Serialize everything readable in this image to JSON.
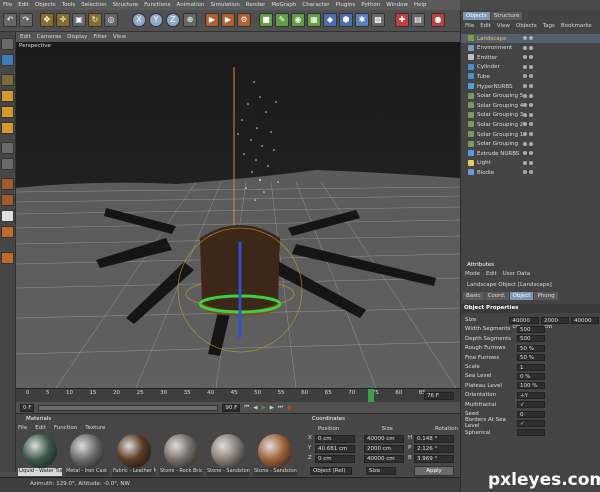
{
  "menu": [
    "File",
    "Edit",
    "Objects",
    "Tools",
    "Selection",
    "Structure",
    "Functions",
    "Animation",
    "Simulation",
    "Render",
    "MoGraph",
    "Character",
    "Plugins",
    "Python",
    "Window",
    "Help"
  ],
  "toolbar": {
    "axis_x": "X",
    "axis_y": "Y",
    "axis_z": "Z"
  },
  "viewport": {
    "menu": [
      "Edit",
      "Cameras",
      "Display",
      "Filter",
      "View"
    ],
    "label": "Perspective"
  },
  "timeline": {
    "ticks": [
      "0",
      "5",
      "10",
      "15",
      "20",
      "25",
      "30",
      "35",
      "40",
      "45",
      "50",
      "55",
      "60",
      "65",
      "70",
      "75",
      "80",
      "85"
    ],
    "end_frame": "76 F"
  },
  "transport": {
    "start": "0 F",
    "end": "90 F"
  },
  "materials": {
    "title": "Materials",
    "menu": [
      "File",
      "Edit",
      "Function",
      "Texture"
    ],
    "items": [
      {
        "label": "Liquid - Water Tur",
        "color": "#3d5a4c"
      },
      {
        "label": "Metal - Iron Cast",
        "color": "#6c6c6c"
      },
      {
        "label": "Fabric - Leather N",
        "color": "#5a3a24"
      },
      {
        "label": "Stone - Rock Bric",
        "color": "#7a706a"
      },
      {
        "label": "Stone - Sandstone",
        "color": "#8a7f78"
      },
      {
        "label": "Stone - Sandstone",
        "color": "#a0623a"
      }
    ]
  },
  "coordinates": {
    "title": "Coordinates",
    "headers": [
      "Position",
      "Size",
      "Rotation"
    ],
    "rows": [
      {
        "axis": "X",
        "position": "0 cm",
        "size": "40000 cm",
        "rot_axis": "H",
        "rotation": "0.148 °"
      },
      {
        "axis": "Y",
        "position": "40.681 cm",
        "size": "2000 cm",
        "rot_axis": "P",
        "rotation": "2.126 °"
      },
      {
        "axis": "Z",
        "position": "0 cm",
        "size": "40000 cm",
        "rot_axis": "B",
        "rotation": "3.969 °"
      }
    ],
    "mode": "Object (Rel)",
    "size_mode": "Size",
    "apply": "Apply"
  },
  "status": "Azimuth: 129.0°, Altitude: -0.0°, NW",
  "objects_panel": {
    "tabs": [
      "Objects",
      "Structure"
    ],
    "menu": [
      "File",
      "Edit",
      "View",
      "Objects",
      "Tags",
      "Bookmarks"
    ],
    "items": [
      "Landscape",
      "Environment",
      "Emitter",
      "Cylinder",
      "Tube",
      "HyperNURBS",
      "Solar Grouping 5",
      "Solar Grouping 4",
      "Solar Grouping 3",
      "Solar Grouping 2",
      "Solar Grouping 1",
      "Solar Grouping",
      "Extrude NURBS",
      "Light",
      "Biodie"
    ]
  },
  "attributes": {
    "title": "Attributes",
    "menu": [
      "Mode",
      "Edit",
      "User Data"
    ],
    "object_name": "Landscape Object [Landscape]",
    "tabs": [
      "Basic",
      "Coord.",
      "Object",
      "Phong"
    ],
    "active_tab": "Object",
    "section": "Object Properties",
    "rows": [
      {
        "label": "Size",
        "values": [
          "40000 cm",
          "2000 cm",
          "40000"
        ]
      },
      {
        "label": "Width Segments",
        "values": [
          "500"
        ]
      },
      {
        "label": "Depth Segments",
        "values": [
          "500"
        ]
      },
      {
        "label": "Rough Furrows",
        "values": [
          "50 %"
        ]
      },
      {
        "label": "Fine Furrows",
        "values": [
          "50 %"
        ]
      },
      {
        "label": "Scale",
        "values": [
          "1"
        ]
      },
      {
        "label": "Sea Level",
        "values": [
          "0 %"
        ]
      },
      {
        "label": "Plateau Level",
        "values": [
          "100 %"
        ]
      },
      {
        "label": "Orientation",
        "values": [
          "+Y"
        ]
      },
      {
        "label": "Multifractal",
        "values": [
          "✓"
        ]
      },
      {
        "label": "Seed",
        "values": [
          "0"
        ]
      },
      {
        "label": "Borders At Sea Level",
        "values": [
          "✓"
        ]
      },
      {
        "label": "Spherical",
        "values": [
          ""
        ]
      }
    ]
  },
  "watermark": "pxleyes.com"
}
